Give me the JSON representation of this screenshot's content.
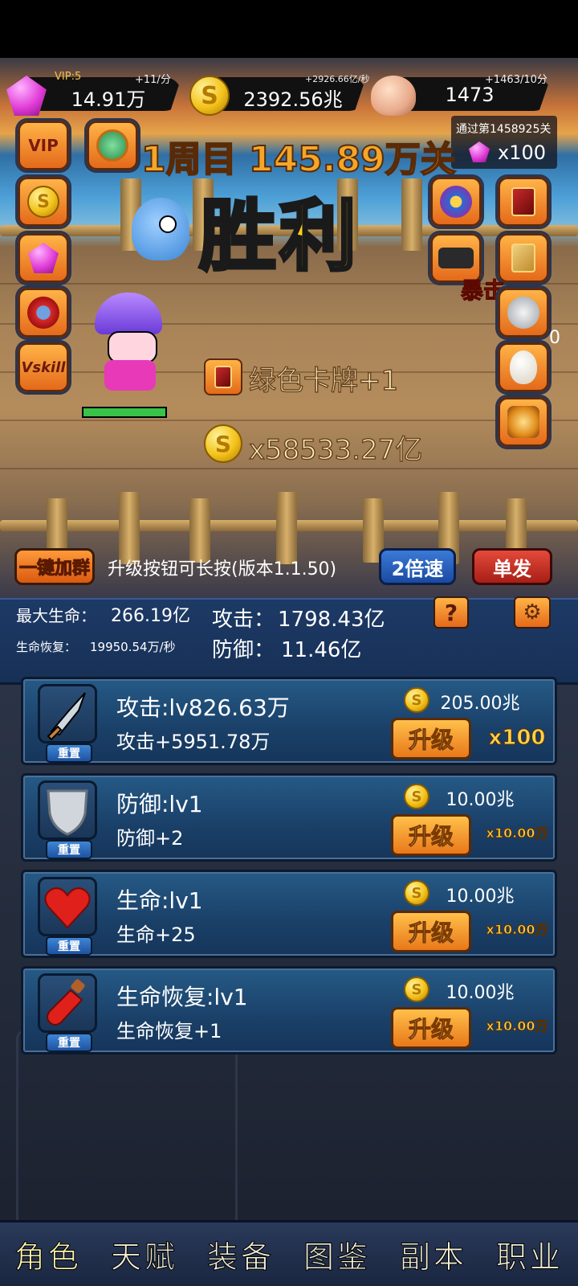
{
  "resources": {
    "gem": {
      "vip": "VIP:5",
      "rate": "+11/分",
      "value": "14.91万"
    },
    "gold": {
      "rate": "+2926.66亿/秒",
      "value": "2392.56兆"
    },
    "skull": {
      "rate": "+1463/10分",
      "value": "1473"
    }
  },
  "pass_reward": {
    "title": "通过第1458925关",
    "amount": "x100"
  },
  "level_title": "1周目 145.89万关",
  "victory": "胜利",
  "crit_text": "暴击",
  "side_number": "0",
  "left_buttons": [
    {
      "name": "vip",
      "label": "VIP"
    },
    {
      "name": "medal",
      "label": ""
    },
    {
      "name": "gold-coin",
      "label": ""
    },
    {
      "name": "gem",
      "label": ""
    },
    {
      "name": "magnet",
      "label": ""
    },
    {
      "name": "vskill",
      "label": "Vskill"
    }
  ],
  "rewards": {
    "card": "绿色卡牌+1",
    "gold": "x58533.27亿"
  },
  "controls": {
    "join_group": "一键加群",
    "hint": "升级按钮可长按(版本1.1.50)",
    "speed": "2倍速",
    "single": "单发"
  },
  "stats": {
    "max_hp_label": "最大生命：",
    "max_hp": "266.19亿",
    "regen_label": "生命恢复：",
    "regen": "19950.54万/秒",
    "attack_label": "攻击：",
    "attack": "1798.43亿",
    "defense_label": "防御：",
    "defense": "11.46亿",
    "help": "?"
  },
  "upgrades": [
    {
      "name": "攻击:lv826.63万",
      "desc": "攻击+5951.78万",
      "cost": "205.00兆",
      "button": "升级",
      "mult": "x100",
      "reset": "重置",
      "icon": "dagger-icon"
    },
    {
      "name": "防御:lv1",
      "desc": "防御+2",
      "cost": "10.00兆",
      "button": "升级",
      "mult": "x10.00万",
      "reset": "重置",
      "icon": "shield-icon"
    },
    {
      "name": "生命:lv1",
      "desc": "生命+25",
      "cost": "10.00兆",
      "button": "升级",
      "mult": "x10.00万",
      "reset": "重置",
      "icon": "heart-icon"
    },
    {
      "name": "生命恢复:lv1",
      "desc": "生命恢复+1",
      "cost": "10.00兆",
      "button": "升级",
      "mult": "x10.00万",
      "reset": "重置",
      "icon": "potion-icon"
    }
  ],
  "nav": [
    "角色",
    "天赋",
    "装备",
    "图鉴",
    "副本",
    "职业"
  ],
  "colors": {
    "accent": "#f3a62a",
    "panel": "#1d3a66",
    "button_orange": "#e8781a"
  }
}
